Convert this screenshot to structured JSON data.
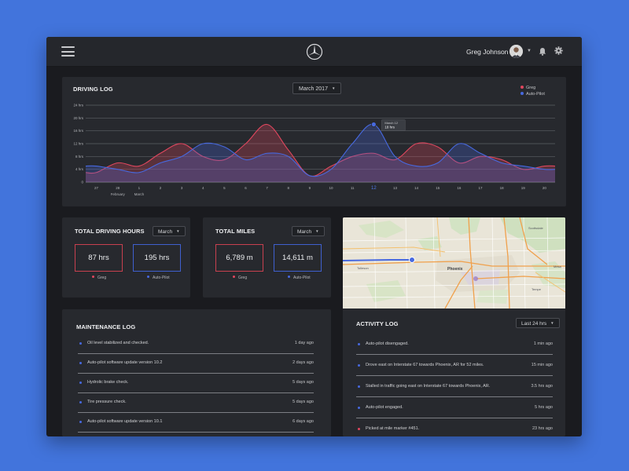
{
  "header": {
    "user_name": "Greg Johnson"
  },
  "driving_log": {
    "title": "DRIVING LOG",
    "month_select": "March 2017",
    "legend": [
      {
        "label": "Greg",
        "color": "#e0475e"
      },
      {
        "label": "Auto-Pilot",
        "color": "#4769e0"
      }
    ],
    "tooltip": {
      "date": "March 12",
      "value": "18 hrs"
    },
    "chart_data": {
      "type": "area",
      "x": [
        "27",
        "28",
        "1",
        "2",
        "3",
        "4",
        "5",
        "6",
        "7",
        "8",
        "9",
        "10",
        "11",
        "12",
        "13",
        "14",
        "15",
        "16",
        "17",
        "18",
        "19",
        "20"
      ],
      "month_labels": [
        "February",
        "March"
      ],
      "yticks": [
        "0",
        "4 hrs",
        "8 hrs",
        "12 hrs",
        "16 hrs",
        "20 hrs",
        "24 hrs"
      ],
      "ylim": [
        0,
        24
      ],
      "highlight_x": "12",
      "series": [
        {
          "name": "Greg",
          "color": "#e0475e",
          "values": [
            3,
            6,
            5,
            9,
            12,
            8,
            7,
            12,
            18,
            10,
            2,
            5,
            8,
            9,
            7,
            12,
            11,
            6,
            8,
            7,
            4,
            5
          ]
        },
        {
          "name": "Auto-Pilot",
          "color": "#4769e0",
          "values": [
            5,
            4,
            3,
            6,
            8,
            12,
            11,
            7,
            9,
            8,
            2,
            4,
            12,
            18,
            8,
            5,
            6,
            12,
            9,
            6,
            5,
            4
          ]
        }
      ]
    }
  },
  "total_hours": {
    "title": "TOTAL DRIVING HOURS",
    "select": "March",
    "greg_value": "87 hrs",
    "auto_value": "195 hrs",
    "greg_label": "Greg",
    "auto_label": "Auto-Pilot"
  },
  "total_miles": {
    "title": "TOTAL MILES",
    "select": "March",
    "greg_value": "6,789 m",
    "auto_value": "14,611 m",
    "greg_label": "Greg",
    "auto_label": "Auto-Pilot"
  },
  "map": {
    "labels": [
      "Scottsdale",
      "Tolleson",
      "Phoenix",
      "Tempe",
      "Mesa"
    ]
  },
  "maintenance_log": {
    "title": "MAINTENANCE LOG",
    "items": [
      {
        "text": "Oil level stabilized and checked.",
        "time": "1 day ago"
      },
      {
        "text": "Auto-pilot software update version 10.2",
        "time": "2 days ago"
      },
      {
        "text": "Hydrolic brake check.",
        "time": "5 days ago"
      },
      {
        "text": "Tire pressure check.",
        "time": "5 days ago"
      },
      {
        "text": "Auto-pilot software update version 10.1",
        "time": "6 days ago"
      }
    ]
  },
  "activity_log": {
    "title": "ACTIVITY LOG",
    "select": "Last 24 hrs",
    "items": [
      {
        "text": "Auto-pilot disengaged.",
        "time": "1 min ago",
        "color": "#4769e0"
      },
      {
        "text": "Drove east on Interstate 67 towards Phoenix, AR for 52 miles.",
        "time": "15 min ago",
        "color": "#4769e0"
      },
      {
        "text": "Stalled in traffic going east on Interstate 67 towards Phoenix, AR.",
        "time": "3.5 hrs ago",
        "color": "#4769e0"
      },
      {
        "text": "Auto-pilot engaged.",
        "time": "5 hrs ago",
        "color": "#4769e0"
      },
      {
        "text": "Picked at mile marker #451.",
        "time": "23 hrs ago",
        "color": "#e0475e"
      }
    ]
  }
}
